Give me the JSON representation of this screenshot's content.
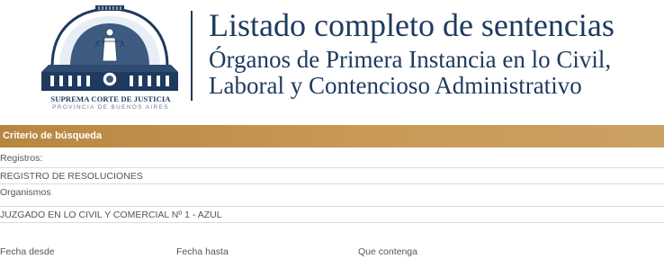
{
  "logo": {
    "title": "SUPREMA CORTE DE JUSTICIA",
    "subtitle": "PROVINCIA DE BUENOS AIRES"
  },
  "header": {
    "title": "Listado completo de sentencias",
    "subtitle_line1": "Órganos de Primera Instancia en lo Civil,",
    "subtitle_line2": "Laboral y Contencioso Administrativo"
  },
  "search": {
    "panel_title": "Criterio de búsqueda",
    "registros_label": "Registros:",
    "registros_value": "REGISTRO DE RESOLUCIONES",
    "organismos_label": "Organismos",
    "organismos_value": "JUZGADO EN LO CIVIL Y COMERCIAL Nº 1 - AZUL",
    "fecha_desde_label": "Fecha desde",
    "fecha_hasta_label": "Fecha hasta",
    "que_contenga_label": "Que contenga"
  },
  "colors": {
    "navy": "#1e3a5f",
    "panel_gold": "#c08f4a"
  }
}
